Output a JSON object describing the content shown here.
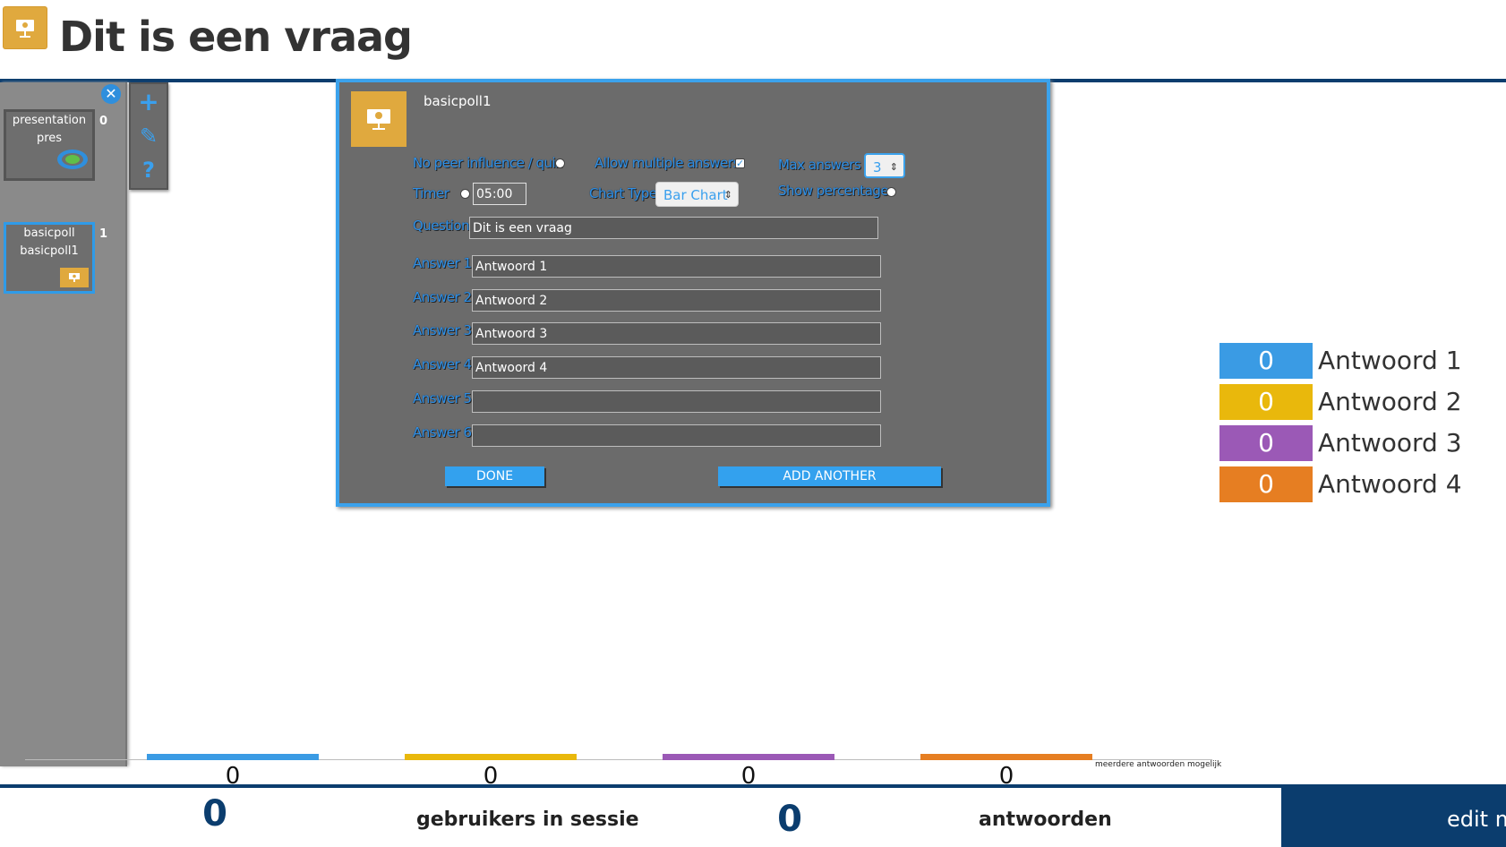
{
  "header": {
    "title": "Dit is een vraag",
    "icon": "presentation-icon"
  },
  "sidebar": {
    "slides": [
      {
        "line1": "presentation",
        "line2": "pres",
        "count": "0",
        "icon": "target-icon"
      },
      {
        "line1": "basicpoll",
        "line2": "basicpoll1",
        "count": "1",
        "icon": "presentation-icon"
      }
    ],
    "close_icon": "close-icon"
  },
  "toolbar": {
    "add": "+",
    "edit": "✎",
    "help": "?"
  },
  "dialog": {
    "title": "basicpoll1",
    "labels": {
      "no_peer": "No peer influence / quiz",
      "allow_multiple": "Allow multiple answers",
      "max_answers": "Max answers",
      "timer": "Timer",
      "chart_type": "Chart Type",
      "show_percentage": "Show percentage",
      "question": "Question"
    },
    "max_answers_value": "3",
    "timer_value": "05:00",
    "chart_type_value": "Bar Chart",
    "question_value": "Dit is een vraag",
    "answers": [
      {
        "label": "Answer 1",
        "value": "Antwoord 1"
      },
      {
        "label": "Answer 2",
        "value": "Antwoord 2"
      },
      {
        "label": "Answer 3",
        "value": "Antwoord 3"
      },
      {
        "label": "Answer 4",
        "value": "Antwoord 4"
      },
      {
        "label": "Answer 5",
        "value": ""
      },
      {
        "label": "Answer 6",
        "value": ""
      }
    ],
    "done_label": "DONE",
    "add_label": "ADD ANOTHER"
  },
  "legend": [
    {
      "count": "0",
      "label": "Antwoord 1",
      "color": "#3a9be4"
    },
    {
      "count": "0",
      "label": "Antwoord 2",
      "color": "#e9b80c"
    },
    {
      "count": "0",
      "label": "Antwoord 3",
      "color": "#9b59b6"
    },
    {
      "count": "0",
      "label": "Antwoord 4",
      "color": "#e67e22"
    }
  ],
  "chart_data": {
    "type": "bar",
    "categories": [
      "Antwoord 1",
      "Antwoord 2",
      "Antwoord 3",
      "Antwoord 4"
    ],
    "values": [
      0,
      0,
      0,
      0
    ],
    "colors": [
      "#3a9be4",
      "#e9b80c",
      "#9b59b6",
      "#e67e22"
    ],
    "note": "meerdere antwoorden mogelijk"
  },
  "footer": {
    "users_count": "0",
    "users_label": "gebruikers in sessie",
    "answers_count": "0",
    "answers_label": "antwoorden",
    "edit_label": "edit m"
  }
}
